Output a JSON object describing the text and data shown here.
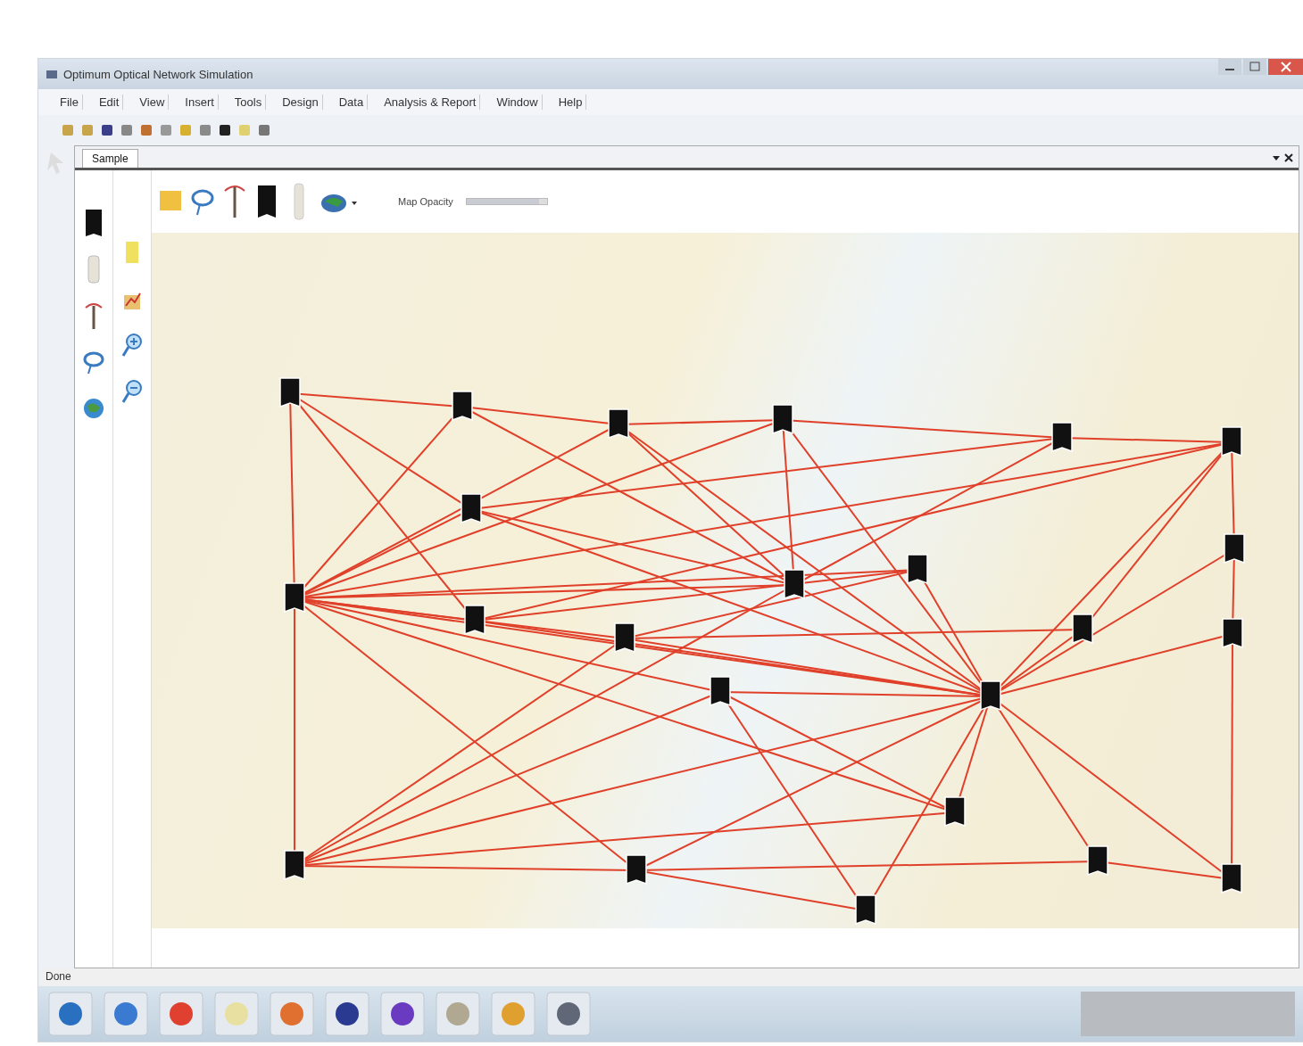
{
  "window": {
    "title": "Optimum Optical Network Simulation"
  },
  "menu": [
    "File",
    "Edit",
    "View",
    "Insert",
    "Tools",
    "Design",
    "Data",
    "Analysis & Report",
    "Window",
    "Help"
  ],
  "tabs": [
    {
      "label": "Sample",
      "selected": true
    }
  ],
  "map_opacity": {
    "label": "Map Opacity",
    "level": 0.9
  },
  "status_bar": {
    "text": "Done"
  }
}
